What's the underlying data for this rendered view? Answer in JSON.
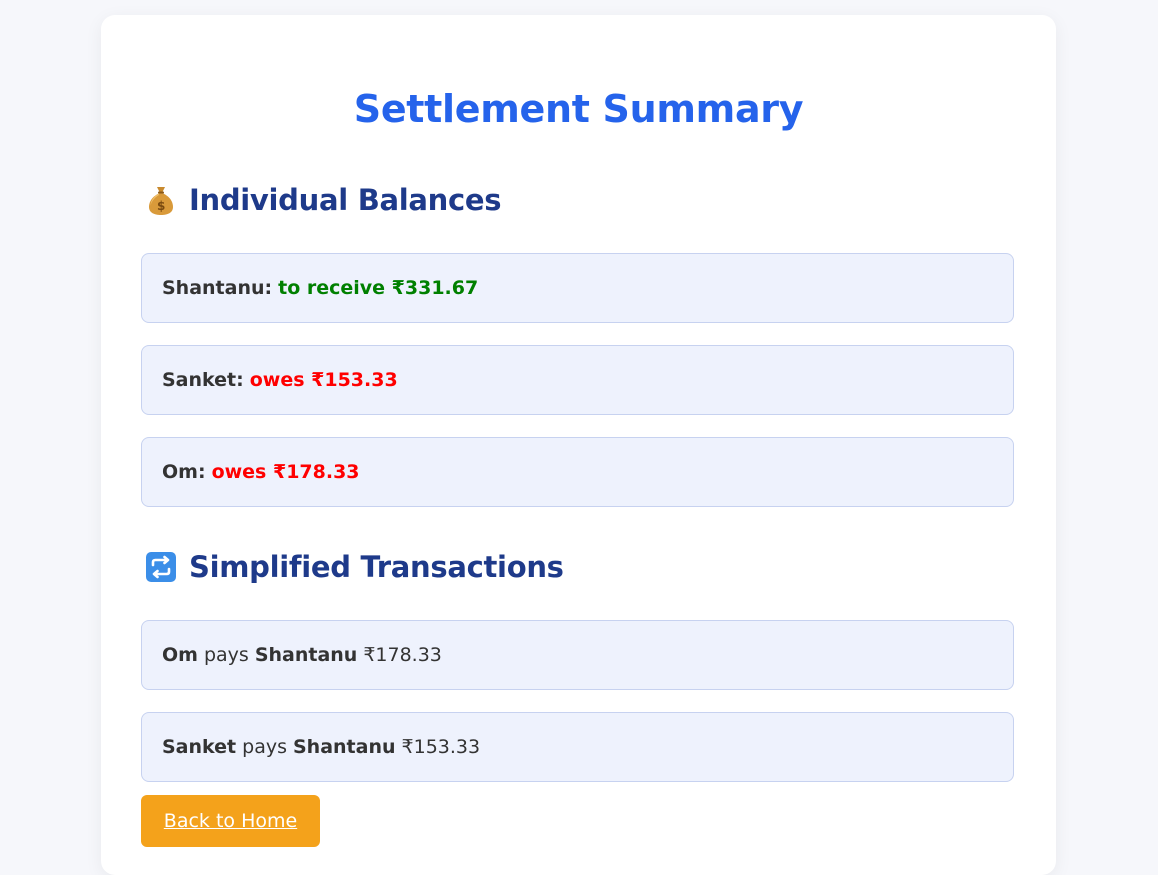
{
  "page": {
    "title": "Settlement Summary"
  },
  "balances": {
    "heading": "Individual Balances",
    "icon": "money-bag-icon",
    "items": [
      {
        "name": "Shantanu:",
        "status": "to receive ₹331.67",
        "kind": "receive",
        "color": "#008000"
      },
      {
        "name": "Sanket:",
        "status": "owes ₹153.33",
        "kind": "owes",
        "color": "#ff0000"
      },
      {
        "name": "Om:",
        "status": "owes ₹178.33",
        "kind": "owes",
        "color": "#ff0000"
      }
    ]
  },
  "transactions": {
    "heading": "Simplified Transactions",
    "icon": "repeat-arrows-icon",
    "items": [
      {
        "from": "Om",
        "verb": "pays",
        "to": "Shantanu",
        "amount": "₹178.33"
      },
      {
        "from": "Sanket",
        "verb": "pays",
        "to": "Shantanu",
        "amount": "₹153.33"
      }
    ]
  },
  "actions": {
    "back_home_label": "Back to Home"
  },
  "colors": {
    "title": "#2563eb",
    "heading": "#1e3a8a",
    "row_bg": "#eef2fd",
    "button_bg": "#f4a21b"
  }
}
